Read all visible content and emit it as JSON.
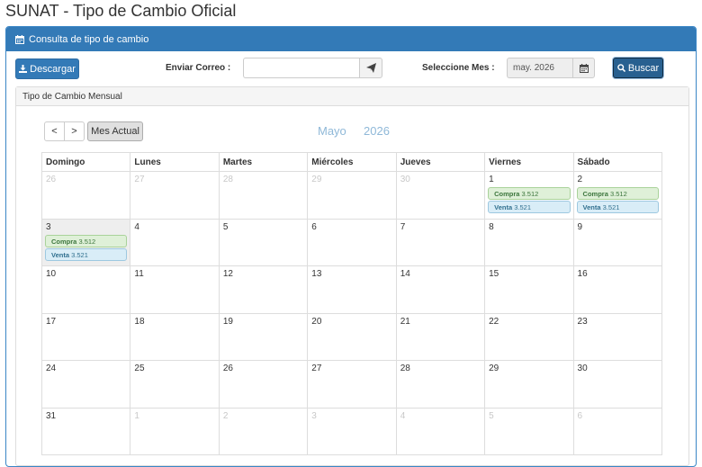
{
  "page_title": "SUNAT - Tipo de Cambio Oficial",
  "panel": {
    "heading": "Consulta de tipo de cambio"
  },
  "toolbar": {
    "download_label": "Descargar",
    "email_label": "Enviar Correo :",
    "email_value": "",
    "month_label": "Seleccione Mes :",
    "month_value": "may. 2026",
    "search_label": "Buscar"
  },
  "calendar": {
    "heading": "Tipo de Cambio Mensual",
    "prev_label": "<",
    "next_label": ">",
    "today_label": "Mes Actual",
    "month": "Mayo",
    "year": "2026",
    "weekdays": [
      "Domingo",
      "Lunes",
      "Martes",
      "Miércoles",
      "Jueves",
      "Viernes",
      "Sábado"
    ],
    "weeks": [
      [
        {
          "day": "26",
          "other": true
        },
        {
          "day": "27",
          "other": true
        },
        {
          "day": "28",
          "other": true
        },
        {
          "day": "29",
          "other": true
        },
        {
          "day": "30",
          "other": true
        },
        {
          "day": "1",
          "compra": "3.512",
          "venta": "3.521"
        },
        {
          "day": "2",
          "compra": "3.512",
          "venta": "3.521"
        }
      ],
      [
        {
          "day": "3",
          "today": true,
          "compra": "3.512",
          "venta": "3.521"
        },
        {
          "day": "4"
        },
        {
          "day": "5"
        },
        {
          "day": "6"
        },
        {
          "day": "7"
        },
        {
          "day": "8"
        },
        {
          "day": "9"
        }
      ],
      [
        {
          "day": "10"
        },
        {
          "day": "11"
        },
        {
          "day": "12"
        },
        {
          "day": "13"
        },
        {
          "day": "14"
        },
        {
          "day": "15"
        },
        {
          "day": "16"
        }
      ],
      [
        {
          "day": "17"
        },
        {
          "day": "18"
        },
        {
          "day": "19"
        },
        {
          "day": "20"
        },
        {
          "day": "21"
        },
        {
          "day": "22"
        },
        {
          "day": "23"
        }
      ],
      [
        {
          "day": "24"
        },
        {
          "day": "25"
        },
        {
          "day": "26"
        },
        {
          "day": "27"
        },
        {
          "day": "28"
        },
        {
          "day": "29"
        },
        {
          "day": "30"
        }
      ],
      [
        {
          "day": "31"
        },
        {
          "day": "1",
          "other": true
        },
        {
          "day": "2",
          "other": true
        },
        {
          "day": "3",
          "other": true
        },
        {
          "day": "4",
          "other": true
        },
        {
          "day": "5",
          "other": true
        },
        {
          "day": "6",
          "other": true
        }
      ]
    ],
    "compra_label": "Compra",
    "venta_label": "Venta"
  },
  "icons": {
    "heading": "calendar-icon",
    "download": "download-icon",
    "send": "paper-plane-icon",
    "month_picker": "calendar-icon",
    "search": "search-icon"
  },
  "colors": {
    "primary": "#337ab7",
    "compra_bg": "#dff0d8",
    "venta_bg": "#d9edf7",
    "month_title": "#8fb8d8"
  }
}
